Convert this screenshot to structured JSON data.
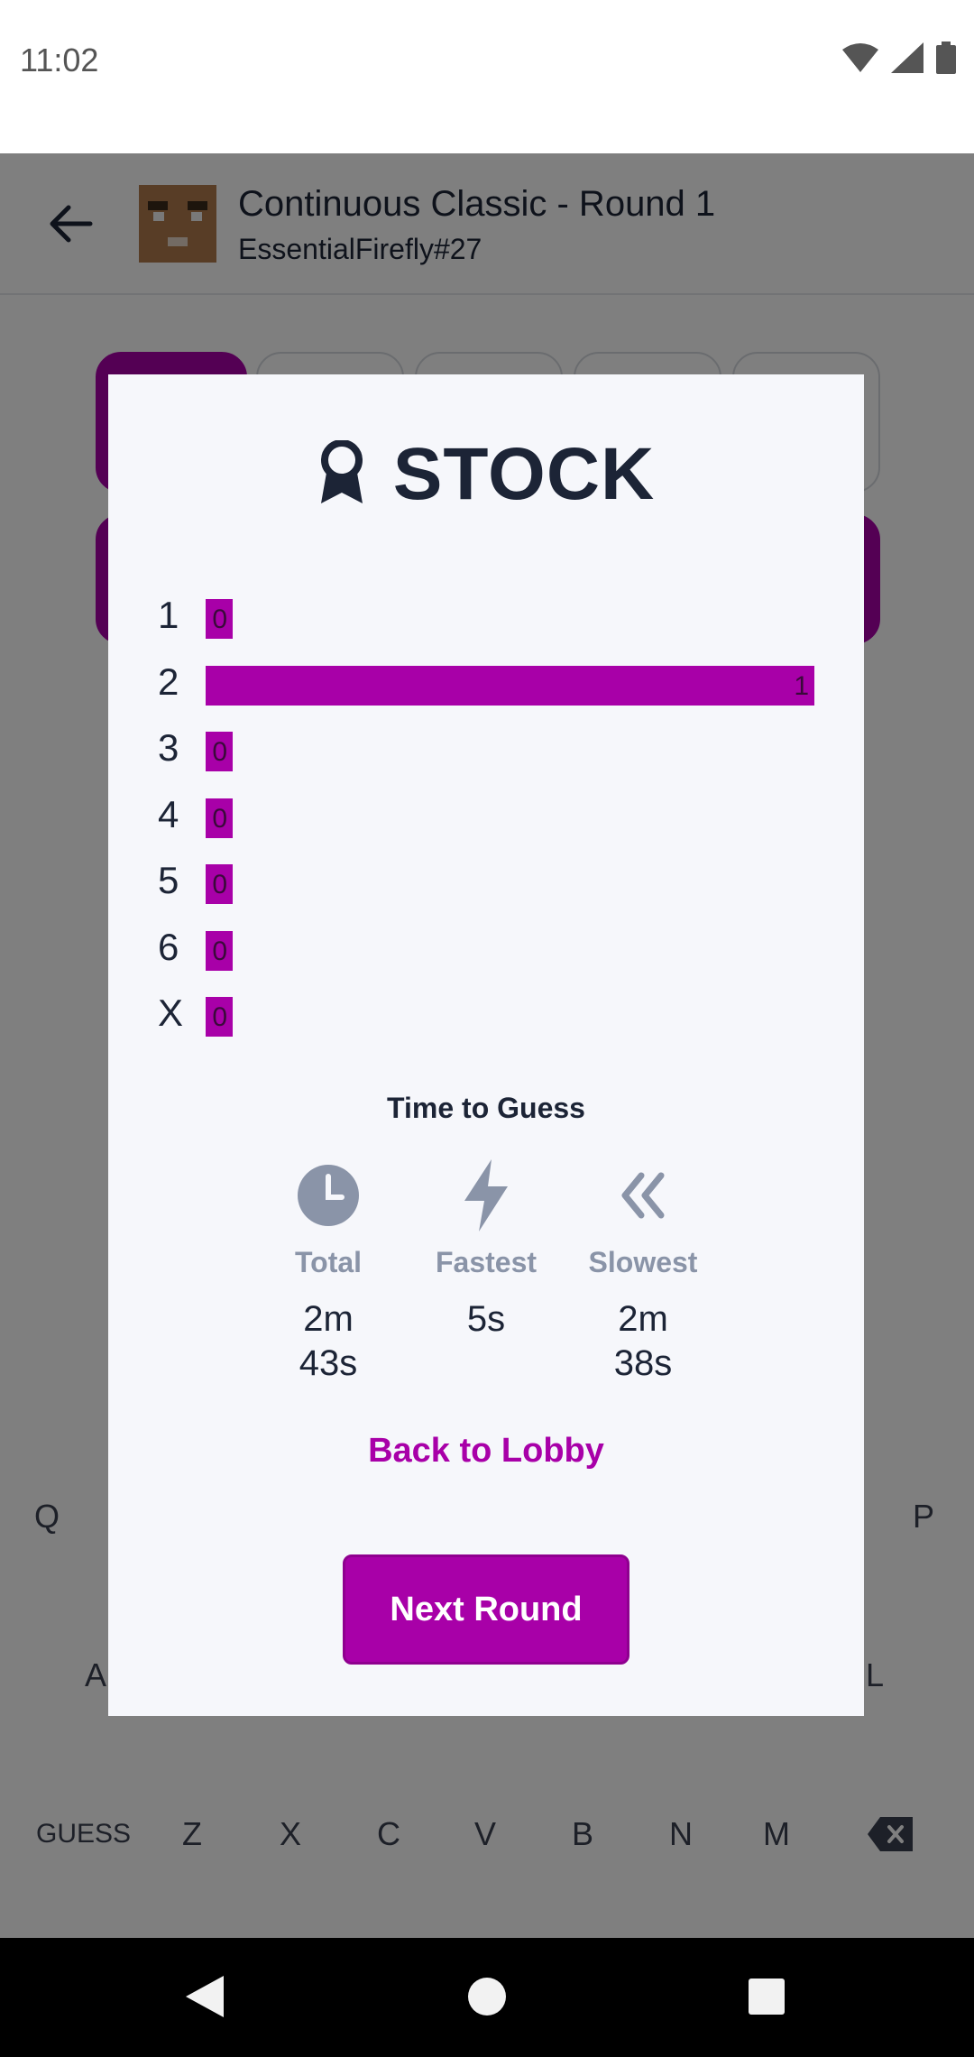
{
  "status_bar": {
    "time": "11:02"
  },
  "app_bar": {
    "title": "Continuous Classic - Round 1",
    "subtitle": "EssentialFirefly#27"
  },
  "keyboard": {
    "row1": [
      "Q",
      "P"
    ],
    "row2": [
      "A",
      "L"
    ],
    "row3": [
      "GUESS",
      "Z",
      "X",
      "C",
      "V",
      "B",
      "N",
      "M"
    ],
    "icons": [
      "backspace-icon"
    ]
  },
  "dialog": {
    "title": "STOCK",
    "title_icon": "award-ribbon-icon",
    "distribution": [
      {
        "label": "1",
        "count": "0",
        "value": 0
      },
      {
        "label": "2",
        "count": "1",
        "value": 1
      },
      {
        "label": "3",
        "count": "0",
        "value": 0
      },
      {
        "label": "4",
        "count": "0",
        "value": 0
      },
      {
        "label": "5",
        "count": "0",
        "value": 0
      },
      {
        "label": "6",
        "count": "0",
        "value": 0
      },
      {
        "label": "X",
        "count": "0",
        "value": 0
      }
    ],
    "time_to_guess": {
      "heading": "Time to Guess",
      "total": {
        "label": "Total",
        "value": "2m 43s",
        "icon": "clock-icon"
      },
      "fastest": {
        "label": "Fastest",
        "value": "5s",
        "icon": "lightning-icon"
      },
      "slowest": {
        "label": "Slowest",
        "value": "2m 38s",
        "icon": "double-chevron-left-icon"
      }
    },
    "back_to_lobby": "Back to Lobby",
    "next_round": "Next Round"
  },
  "colors": {
    "accent": "#a800a8",
    "text_dark": "#1c2436",
    "text_muted": "#8a94a8",
    "dialog_bg": "#f6f7fb"
  }
}
